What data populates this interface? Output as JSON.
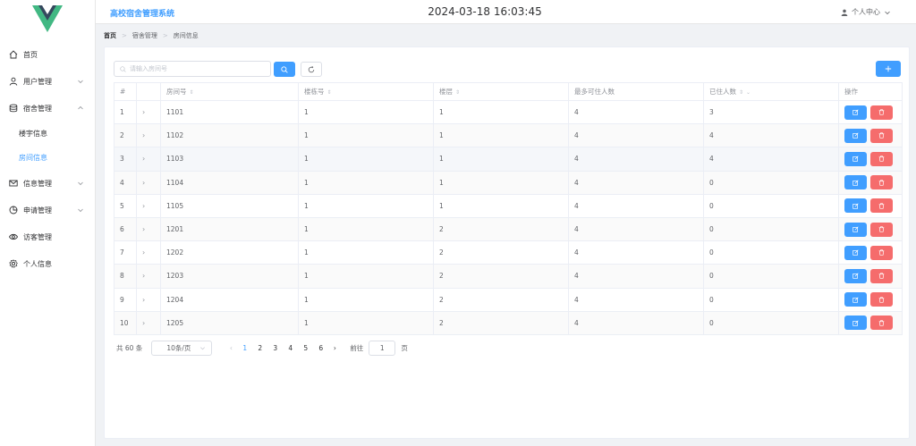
{
  "header": {
    "system_title": "高校宿舍管理系统",
    "datetime": "2024-03-18 16:03:45",
    "user_menu_label": "个人中心"
  },
  "sidebar": {
    "items": [
      {
        "label": "首页",
        "icon": "home-icon"
      },
      {
        "label": "用户管理",
        "icon": "user-icon"
      },
      {
        "label": "宿舍管理",
        "icon": "database-icon"
      },
      {
        "label": "信息管理",
        "icon": "mail-icon"
      },
      {
        "label": "申请管理",
        "icon": "pie-chart-icon"
      },
      {
        "label": "访客管理",
        "icon": "eye-icon"
      },
      {
        "label": "个人信息",
        "icon": "gear-icon"
      }
    ],
    "subitems": [
      {
        "label": "楼宇信息"
      },
      {
        "label": "房间信息"
      }
    ]
  },
  "breadcrumb": [
    "首页",
    "宿舍管理",
    "房间信息"
  ],
  "search": {
    "placeholder": "请输入房间号",
    "value": ""
  },
  "table": {
    "headers": {
      "index": "#",
      "room": "房间号",
      "building": "楼栋号",
      "floor": "楼层",
      "capacity": "最多可住人数",
      "occupied": "已住人数",
      "actions": "操作"
    },
    "rows": [
      {
        "index": "1",
        "room": "1101",
        "building": "1",
        "floor": "1",
        "capacity": "4",
        "occupied": "3"
      },
      {
        "index": "2",
        "room": "1102",
        "building": "1",
        "floor": "1",
        "capacity": "4",
        "occupied": "4"
      },
      {
        "index": "3",
        "room": "1103",
        "building": "1",
        "floor": "1",
        "capacity": "4",
        "occupied": "4"
      },
      {
        "index": "4",
        "room": "1104",
        "building": "1",
        "floor": "1",
        "capacity": "4",
        "occupied": "0"
      },
      {
        "index": "5",
        "room": "1105",
        "building": "1",
        "floor": "1",
        "capacity": "4",
        "occupied": "0"
      },
      {
        "index": "6",
        "room": "1201",
        "building": "1",
        "floor": "2",
        "capacity": "4",
        "occupied": "0"
      },
      {
        "index": "7",
        "room": "1202",
        "building": "1",
        "floor": "2",
        "capacity": "4",
        "occupied": "0"
      },
      {
        "index": "8",
        "room": "1203",
        "building": "1",
        "floor": "2",
        "capacity": "4",
        "occupied": "0"
      },
      {
        "index": "9",
        "room": "1204",
        "building": "1",
        "floor": "2",
        "capacity": "4",
        "occupied": "0"
      },
      {
        "index": "10",
        "room": "1205",
        "building": "1",
        "floor": "2",
        "capacity": "4",
        "occupied": "0"
      }
    ]
  },
  "pagination": {
    "total_label": "共 60 条",
    "page_size": "10条/页",
    "pages": [
      "1",
      "2",
      "3",
      "4",
      "5",
      "6"
    ],
    "current_page": "1",
    "jump_label": "前往",
    "jump_value": "1",
    "page_suffix": "页"
  },
  "colors": {
    "primary": "#409eff",
    "danger": "#f56c6c",
    "logo_green": "#41b883",
    "logo_dark": "#35495e"
  }
}
